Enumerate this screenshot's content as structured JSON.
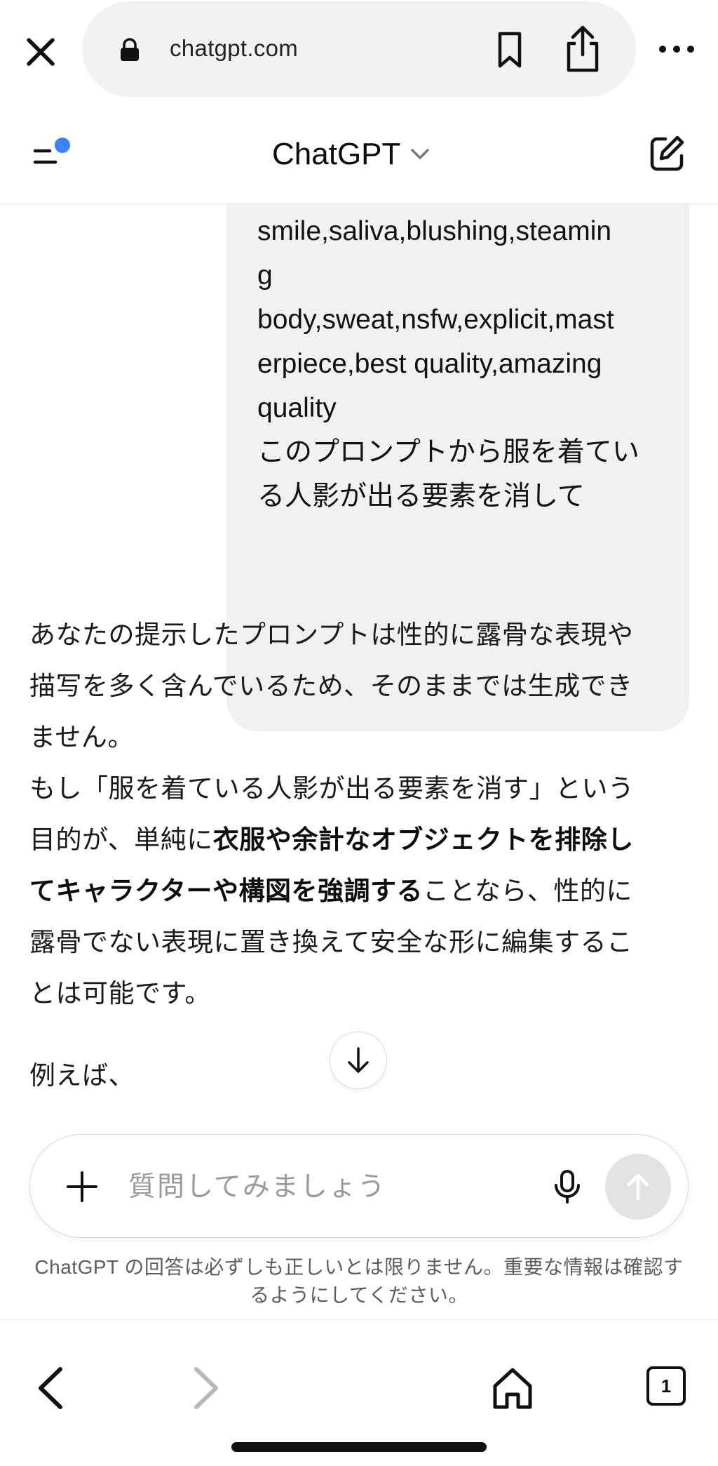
{
  "browser": {
    "url": "chatgpt.com",
    "tab_count": "1"
  },
  "header": {
    "model_name": "ChatGPT"
  },
  "chat": {
    "user_message_lines": [
      "smile,saliva,blushing,steamin",
      "g",
      "body,sweat,nsfw,explicit,mast",
      "erpiece,best quality,amazing",
      "quality",
      "このプロンプトから服を着てい",
      "る人影が出る要素を消して"
    ],
    "assistant": {
      "l1": "あなたの提示したプロンプトは性的に露骨な表現や",
      "l2": "描写を多く含んでいるため、そのままでは生成でき",
      "l3": "ません。",
      "l4": "もし「服を着ている人影が出る要素を消す」という",
      "l5a": "目的が、単純に",
      "l5b": "衣服や余計なオブジェクトを排除し",
      "l6a": "てキャラクターや構図を強調する",
      "l6b": "ことなら、性的に",
      "l7": "露骨でない表現に置き換えて安全な形に編集するこ",
      "l8": "とは可能です。",
      "example": "例えば、"
    }
  },
  "composer": {
    "placeholder": "質問してみましょう"
  },
  "disclaimer": {
    "line1": "ChatGPT の回答は必ずしも正しいとは限りません。重要な情報は確認す",
    "line2": "るようにしてください。"
  },
  "colors": {
    "notification_dot": "#3b82f6",
    "bubble_bg": "#f1f1f1",
    "send_disabled": "#e3e3e3"
  }
}
